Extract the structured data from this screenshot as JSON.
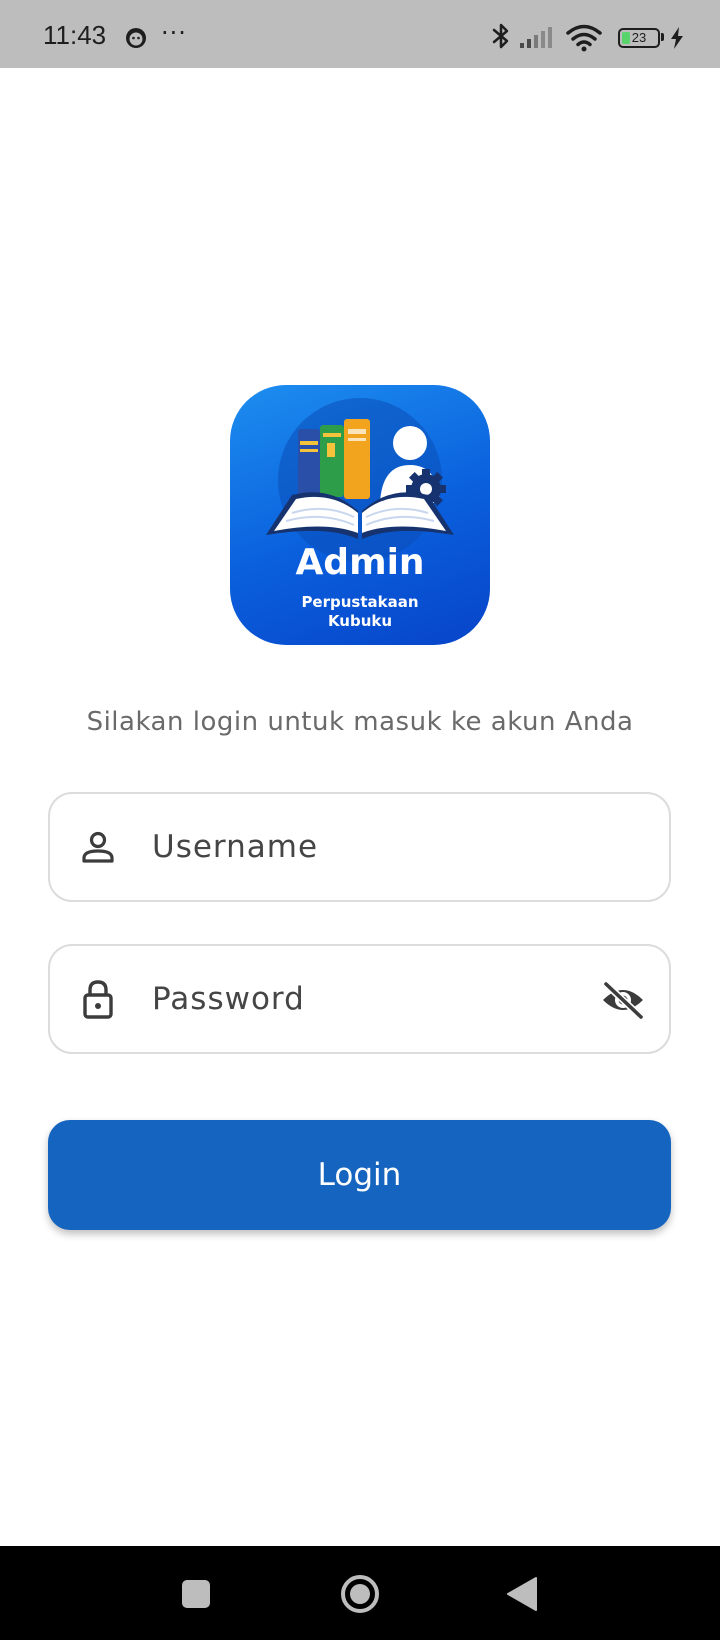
{
  "status_bar": {
    "time": "11:43",
    "more_indicator": "···",
    "battery_level": "23",
    "battery_percent": 23,
    "icons": [
      "face-notification-icon",
      "bluetooth-icon",
      "signal-icon",
      "wifi-icon",
      "battery-icon",
      "charging-icon"
    ]
  },
  "app_icon": {
    "title": "Admin",
    "subtitle_line1": "Perpustakaan",
    "subtitle_line2": "Kubuku"
  },
  "login": {
    "instruction": "Silakan login untuk masuk ke akun Anda",
    "username_placeholder": "Username",
    "password_placeholder": "Password",
    "button_label": "Login"
  },
  "colors": {
    "primary": "#1565c0",
    "status_bar_bg": "#bdbdbd",
    "icon_gradient_start": "#1d8ef0",
    "icon_gradient_end": "#0744c9"
  },
  "nav_bar": {
    "buttons": [
      "recents-square-icon",
      "home-circle-icon",
      "back-triangle-icon"
    ]
  }
}
